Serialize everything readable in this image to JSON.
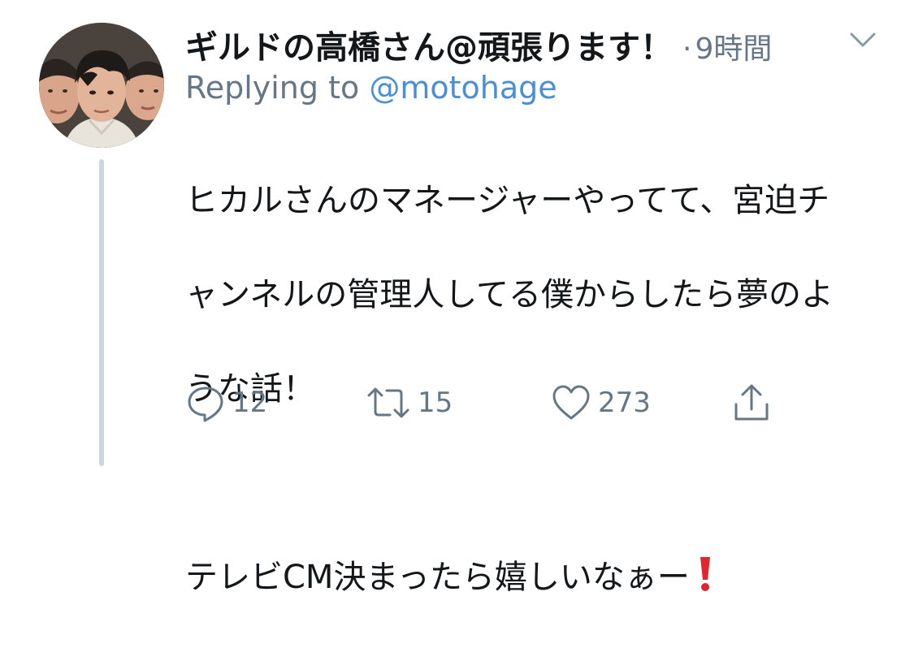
{
  "tweet": {
    "display_name": "ギルドの高橋さん@頑張ります！",
    "separator": "·",
    "time": "9時間",
    "replying_prefix": "Replying to",
    "replying_handle": "@motohage",
    "body_lines": [
      "ヒカルさんのマネージャーやってて、宮迫チ",
      "ャンネルの管理人してる僕からしたら夢のよ",
      "うな話！",
      "",
      "テレビCM決まったら嬉しいなぁー"
    ],
    "emoji": "red-exclamation-mark"
  },
  "actions": {
    "reply_count": "12",
    "retweet_count": "15",
    "like_count": "273"
  },
  "icons": {
    "more": "chevron-down-icon",
    "reply": "speech-bubble-icon",
    "retweet": "retweet-arrows-icon",
    "like": "heart-icon",
    "share": "share-upload-icon"
  },
  "colors": {
    "text": "#14171a",
    "secondary": "#657786",
    "link": "#4a8fd6",
    "thread_line": "#ccd6dd",
    "emoji_red": "#e0252e"
  }
}
